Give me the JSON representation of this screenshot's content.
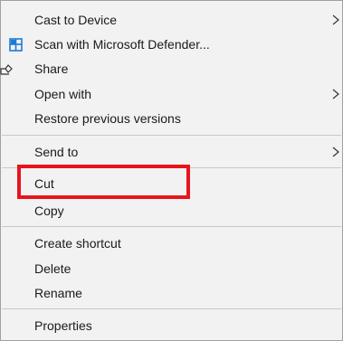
{
  "menu": {
    "items": [
      {
        "label": "Cast to Device",
        "submenu": true
      },
      {
        "label": "Scan with Microsoft Defender...",
        "icon": "defender-shield-icon"
      },
      {
        "label": "Share",
        "icon": "share-icon"
      },
      {
        "label": "Open with",
        "submenu": true
      },
      {
        "label": "Restore previous versions"
      },
      {
        "label": "Send to",
        "submenu": true
      },
      {
        "label": "Cut",
        "highlighted": true
      },
      {
        "label": "Copy"
      },
      {
        "label": "Create shortcut"
      },
      {
        "label": "Delete"
      },
      {
        "label": "Rename"
      },
      {
        "label": "Properties"
      }
    ]
  },
  "colors": {
    "menu_background": "#f2f2f2",
    "separator": "#c8c8c8",
    "highlight_box": "#e8141c",
    "defender_icon": "#1e7bd6",
    "text": "#1a1a1a"
  }
}
